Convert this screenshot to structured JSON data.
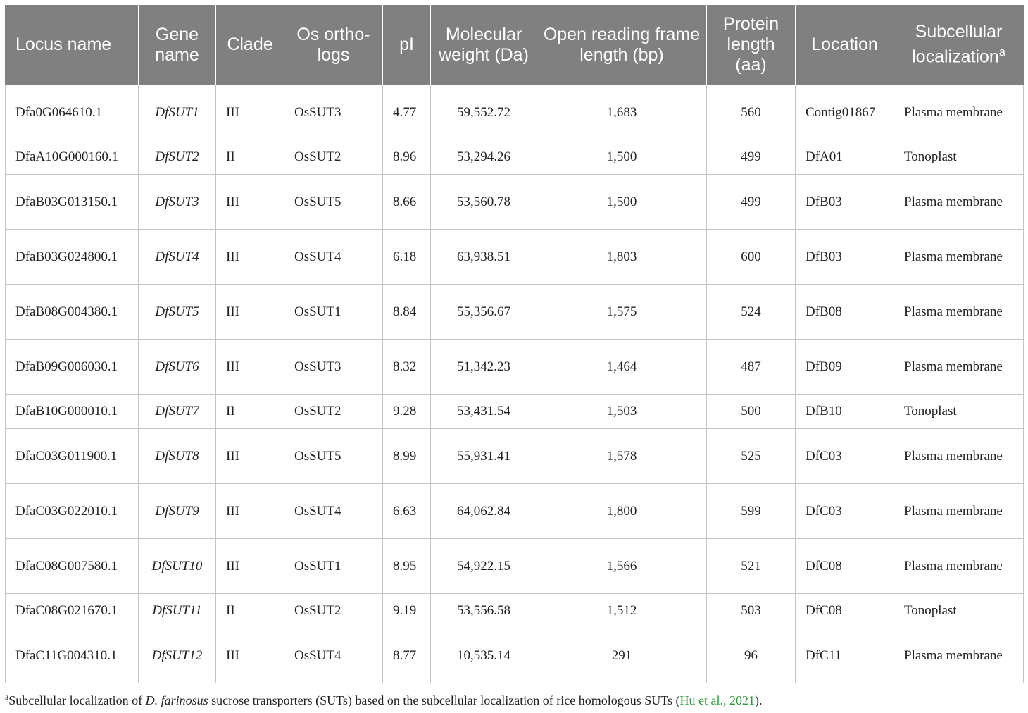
{
  "headers": {
    "locus": "Locus name",
    "gene": "Gene name",
    "clade": "Clade",
    "ortho": "Os ortho-logs",
    "pi": "pI",
    "mw": "Molecular weight (Da)",
    "orf": "Open reading frame length (bp)",
    "prot": "Protein length (aa)",
    "loc": "Location",
    "sub": "Subcellular localization",
    "sub_sup": "a"
  },
  "rows": [
    {
      "locus": "Dfa0G064610.1",
      "gene": "DfSUT1",
      "clade": "III",
      "ortho": "OsSUT3",
      "pi": "4.77",
      "mw": "59,552.72",
      "orf": "1,683",
      "prot": "560",
      "loc": "Contig01867",
      "sub": "Plasma membrane"
    },
    {
      "locus": "DfaA10G000160.1",
      "gene": "DfSUT2",
      "clade": "II",
      "ortho": "OsSUT2",
      "pi": "8.96",
      "mw": "53,294.26",
      "orf": "1,500",
      "prot": "499",
      "loc": "DfA01",
      "sub": "Tonoplast"
    },
    {
      "locus": "DfaB03G013150.1",
      "gene": "DfSUT3",
      "clade": "III",
      "ortho": "OsSUT5",
      "pi": "8.66",
      "mw": "53,560.78",
      "orf": "1,500",
      "prot": "499",
      "loc": "DfB03",
      "sub": "Plasma membrane"
    },
    {
      "locus": "DfaB03G024800.1",
      "gene": "DfSUT4",
      "clade": "III",
      "ortho": "OsSUT4",
      "pi": "6.18",
      "mw": "63,938.51",
      "orf": "1,803",
      "prot": "600",
      "loc": "DfB03",
      "sub": "Plasma membrane"
    },
    {
      "locus": "DfaB08G004380.1",
      "gene": "DfSUT5",
      "clade": "III",
      "ortho": "OsSUT1",
      "pi": "8.84",
      "mw": "55,356.67",
      "orf": "1,575",
      "prot": "524",
      "loc": "DfB08",
      "sub": "Plasma membrane"
    },
    {
      "locus": "DfaB09G006030.1",
      "gene": "DfSUT6",
      "clade": "III",
      "ortho": "OsSUT3",
      "pi": "8.32",
      "mw": "51,342.23",
      "orf": "1,464",
      "prot": "487",
      "loc": "DfB09",
      "sub": "Plasma membrane"
    },
    {
      "locus": "DfaB10G000010.1",
      "gene": "DfSUT7",
      "clade": "II",
      "ortho": "OsSUT2",
      "pi": "9.28",
      "mw": "53,431.54",
      "orf": "1,503",
      "prot": "500",
      "loc": "DfB10",
      "sub": "Tonoplast"
    },
    {
      "locus": "DfaC03G011900.1",
      "gene": "DfSUT8",
      "clade": "III",
      "ortho": "OsSUT5",
      "pi": "8.99",
      "mw": "55,931.41",
      "orf": "1,578",
      "prot": "525",
      "loc": "DfC03",
      "sub": "Plasma membrane"
    },
    {
      "locus": "DfaC03G022010.1",
      "gene": "DfSUT9",
      "clade": "III",
      "ortho": "OsSUT4",
      "pi": "6.63",
      "mw": "64,062.84",
      "orf": "1,800",
      "prot": "599",
      "loc": "DfC03",
      "sub": "Plasma membrane"
    },
    {
      "locus": "DfaC08G007580.1",
      "gene": "DfSUT10",
      "clade": "III",
      "ortho": "OsSUT1",
      "pi": "8.95",
      "mw": "54,922.15",
      "orf": "1,566",
      "prot": "521",
      "loc": "DfC08",
      "sub": "Plasma membrane"
    },
    {
      "locus": "DfaC08G021670.1",
      "gene": "DfSUT11",
      "clade": "II",
      "ortho": "OsSUT2",
      "pi": "9.19",
      "mw": "53,556.58",
      "orf": "1,512",
      "prot": "503",
      "loc": "DfC08",
      "sub": "Tonoplast"
    },
    {
      "locus": "DfaC11G004310.1",
      "gene": "DfSUT12",
      "clade": "III",
      "ortho": "OsSUT4",
      "pi": "8.77",
      "mw": "10,535.14",
      "orf": "291",
      "prot": "96",
      "loc": "DfC11",
      "sub": "Plasma membrane"
    }
  ],
  "footnote": {
    "sup": "a",
    "pre": "Subcellular localization of ",
    "species": "D. farinosus",
    "post": " sucrose transporters (SUTs) based on the subcellular localization of rice homologous SUTs (",
    "cite": "Hu et al., 2021",
    "end": ")."
  }
}
